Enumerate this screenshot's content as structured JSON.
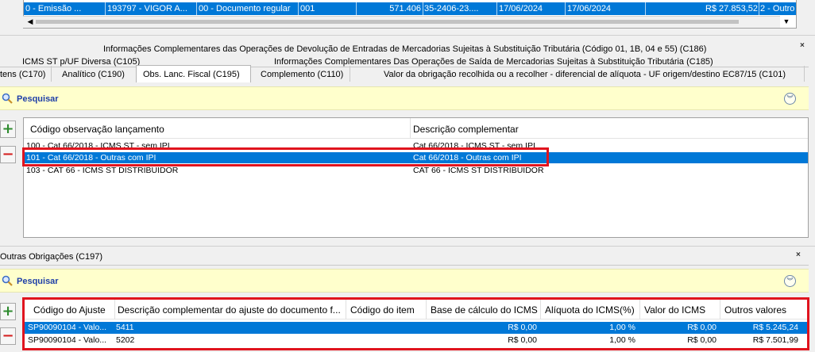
{
  "top_grid": {
    "row": [
      "0 - Emissão ...",
      "193797 - VIGOR A...",
      "00 - Documento regular",
      "001",
      "571.406",
      "35-2406-23....",
      "17/06/2024",
      "17/06/2024",
      "R$ 27.853,52",
      "2 - Outro"
    ]
  },
  "tabs": {
    "row1": "Informações Complementares das Operações de Devolução de Entradas de Mercadorias Sujeitas à Substituição Tributária (Código 01, 1B, 04 e 55) (C186)",
    "row2_left": "ICMS ST p/UF Diversa (C105)",
    "row2_right": "Informações Complementares Das Operações de Saída de Mercadorias Sujeitas à Substituição Tributária (C185)",
    "row3": [
      "tens (C170)",
      "Analítico (C190)",
      "Obs. Lanc. Fiscal (C195)",
      "Complemento (C110)",
      "Valor da obrigação recolhida ou a recolher - diferencial de alíquota - UF origem/destino EC87/15 (C101)"
    ],
    "close": "×"
  },
  "search1": {
    "label": "Pesquisar"
  },
  "grid1": {
    "headers": [
      "Código observação lançamento",
      "Descrição complementar"
    ],
    "rows": [
      [
        "100 - Cat 66/2018 - ICMS ST - sem IPI",
        "Cat 66/2018 - ICMS ST - sem IPI"
      ],
      [
        "101 - Cat 66/2018 - Outras com IPI",
        "Cat 66/2018 - Outras com IPI"
      ],
      [
        "103 - CAT 66 - ICMS ST DISTRIBUIDOR",
        "CAT 66 - ICMS ST DISTRIBUIDOR"
      ]
    ],
    "selected_row": 1
  },
  "section2": {
    "tab": "Outras Obrigações (C197)",
    "close": "×"
  },
  "search2": {
    "label": "Pesquisar"
  },
  "grid2": {
    "headers": [
      "Código do Ajuste",
      "Descrição complementar do ajuste do documento f...",
      "Código do item",
      "Base de cálculo do ICMS",
      "Alíquota do ICMS(%)",
      "Valor do ICMS",
      "Outros valores"
    ],
    "rows": [
      [
        "SP90090104 - Valo...",
        "5411",
        "",
        "R$ 0,00",
        "1,00 %",
        "R$ 0,00",
        "R$ 5.245,24"
      ],
      [
        "SP90090104 - Valo...",
        "5202",
        "",
        "R$ 0,00",
        "1,00 %",
        "R$ 0,00",
        "R$ 7.501,99"
      ]
    ],
    "selected_row": 0
  },
  "buttons": {
    "add": "+",
    "remove": "−"
  },
  "colors": {
    "selection": "#0078d7",
    "highlight_border": "#e0141e",
    "search_bar": "#ffffcc",
    "search_text": "#1f3fa8"
  },
  "icons": [
    "search-icon",
    "collapse-chevron-icon",
    "add-icon",
    "remove-icon",
    "close-icon",
    "scroll-left-icon",
    "scroll-down-icon"
  ]
}
